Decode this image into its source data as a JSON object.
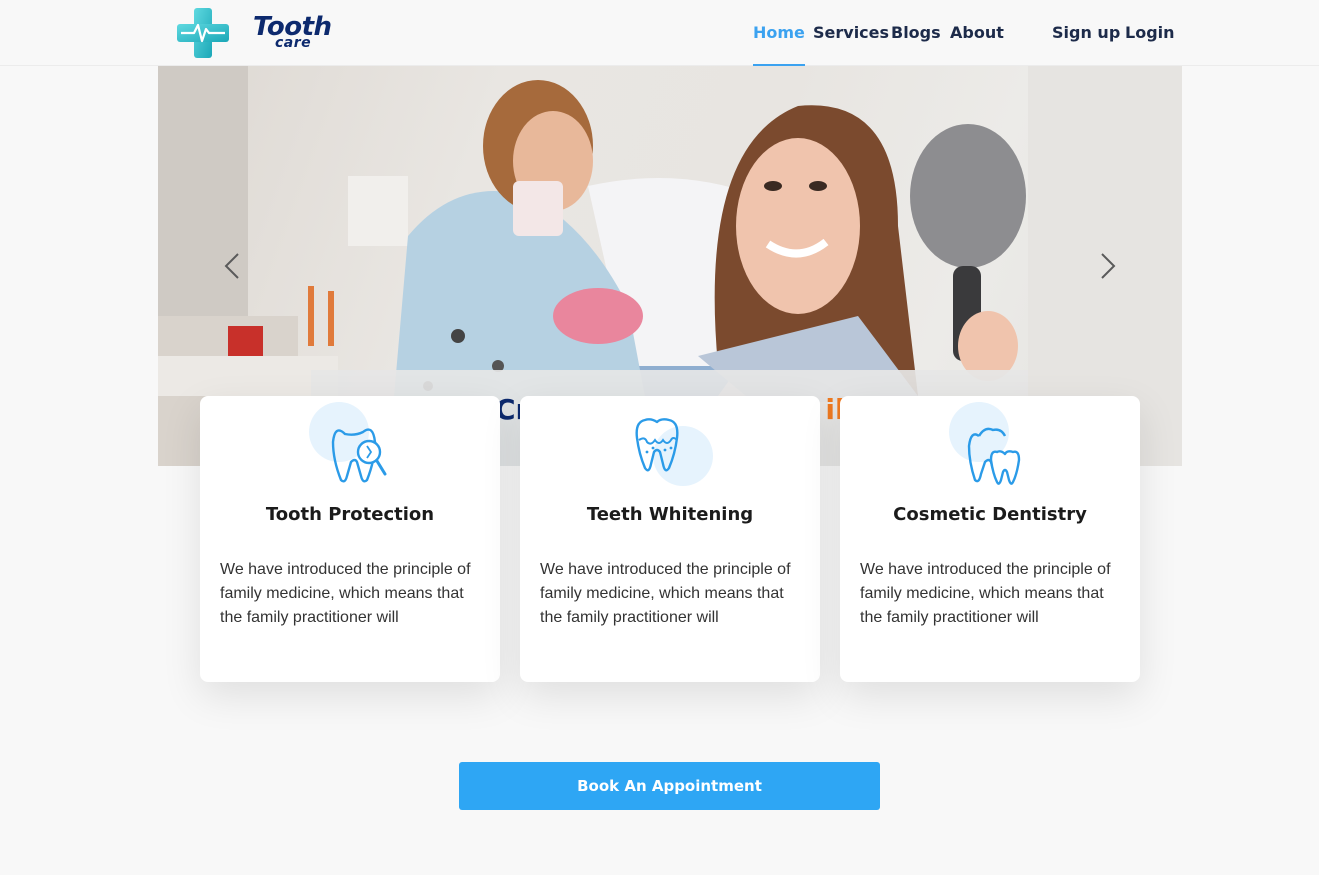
{
  "brand": {
    "name": "Tooth",
    "tagline": "care"
  },
  "nav": {
    "links": [
      {
        "label": "Home",
        "active": true
      },
      {
        "label": "Services",
        "active": false
      },
      {
        "label": "Blogs",
        "active": false
      },
      {
        "label": "About",
        "active": false
      }
    ],
    "auth": [
      {
        "label": "Sign up"
      },
      {
        "label": "Login"
      }
    ]
  },
  "hero": {
    "caption_visible_start": "Cr",
    "caption_visible_end": "ile",
    "prev_icon": "chevron-left-icon",
    "next_icon": "chevron-right-icon"
  },
  "services": [
    {
      "title": "Tooth Protection",
      "text": "We have introduced the principle of family medicine, which means that the family practitioner will",
      "icon": "tooth-magnifier-icon"
    },
    {
      "title": "Teeth Whitening",
      "text": "We have introduced the principle of family medicine, which means that the family practitioner will",
      "icon": "tooth-whitening-icon"
    },
    {
      "title": "Cosmetic Dentistry",
      "text": "We have introduced the principle of family medicine, which means that the family practitioner will",
      "icon": "two-teeth-icon"
    }
  ],
  "cta": {
    "label": "Book An Appointment"
  },
  "colors": {
    "accent": "#3ba2f0",
    "navy": "#0d2a6e",
    "button": "#2ea6f4",
    "caption_orange": "#f07a21",
    "logo_teal": "#2ec4c8"
  }
}
